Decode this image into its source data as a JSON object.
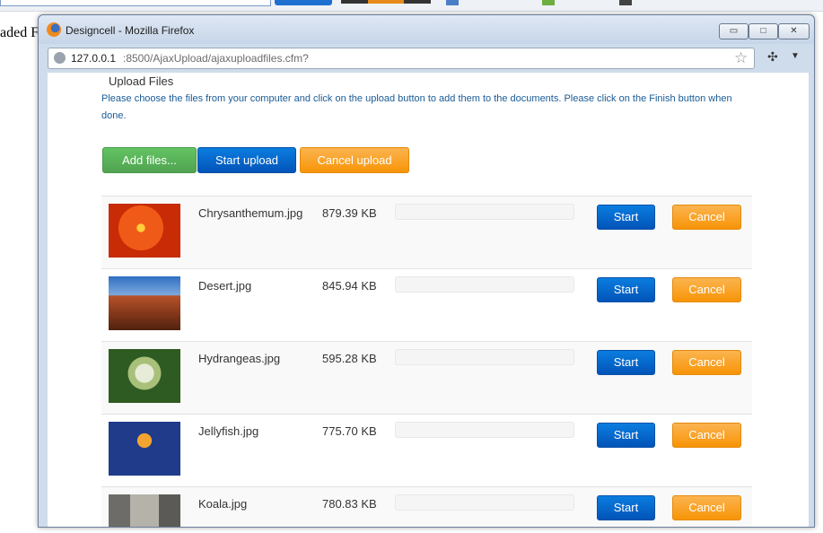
{
  "background": {
    "side_text": "aded Fi"
  },
  "window": {
    "title": "Designcell - Mozilla Firefox",
    "controls": {
      "minimize": "▭",
      "maximize": "□",
      "close": "✕"
    },
    "url_host": "127.0.0.1",
    "url_rest": ":8500/AjaxUpload/ajaxuploadfiles.cfm?"
  },
  "page": {
    "heading": "Upload Files",
    "instructions": "Please choose the files from your computer and click on the upload button to add them to the documents. Please click on the Finish button when done.",
    "buttons": {
      "add_files": "Add files...",
      "start_upload": "Start upload",
      "cancel_upload": "Cancel upload"
    }
  },
  "files": [
    {
      "name": "Chrysanthemum.jpg",
      "size": "879.39 KB",
      "progress": 0,
      "start": "Start",
      "cancel": "Cancel"
    },
    {
      "name": "Desert.jpg",
      "size": "845.94 KB",
      "progress": 0,
      "start": "Start",
      "cancel": "Cancel"
    },
    {
      "name": "Hydrangeas.jpg",
      "size": "595.28 KB",
      "progress": 0,
      "start": "Start",
      "cancel": "Cancel"
    },
    {
      "name": "Jellyfish.jpg",
      "size": "775.70 KB",
      "progress": 0,
      "start": "Start",
      "cancel": "Cancel"
    },
    {
      "name": "Koala.jpg",
      "size": "780.83 KB",
      "progress": 0,
      "start": "Start",
      "cancel": "Cancel"
    }
  ],
  "colors": {
    "add_button": "#5bb75b",
    "start_button": "#0568cc",
    "cancel_button": "#f8a025",
    "instructions_text": "#1a5b96"
  }
}
